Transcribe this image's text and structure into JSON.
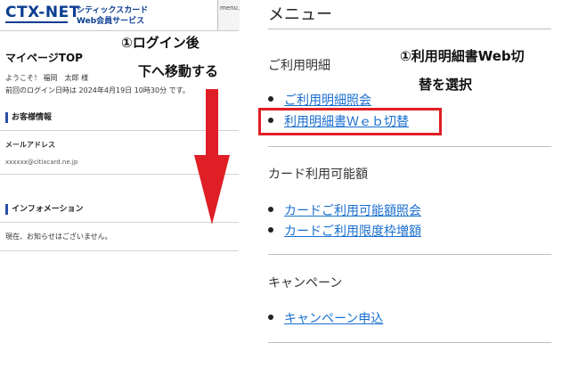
{
  "header": {
    "logo": "CTX-NET",
    "service_line1": "シティックスカード",
    "service_line2": "Web会員サービス",
    "menu_button": "menuメニュー"
  },
  "mypage": {
    "title": "マイページTOP",
    "welcome": "ようこそ！ 福岡　太郎 様",
    "last_login": "前回のログイン日時は 2024年4月19日 10時30分 です。",
    "customer_section": "お客様情報",
    "mail_label": "メールアドレス",
    "mail_value": "xxxxxx@citixcard.ne.jp",
    "info_section": "インフォメーション",
    "info_text": "現在、お知らせはございません。"
  },
  "annotations": {
    "left_line1": "①ログイン後",
    "left_line2": "下へ移動する",
    "right_line1": "①利用明細書Web切",
    "right_line2": "替を選択"
  },
  "menu": {
    "title": "メニュー",
    "groups": [
      {
        "title": "ご利用明細",
        "items": [
          "ご利用明細照会",
          "利用明細書Ｗｅｂ切替"
        ]
      },
      {
        "title": "カード利用可能額",
        "items": [
          "カードご利用可能額照会",
          "カードご利用限度枠増額"
        ]
      },
      {
        "title": "キャンペーン",
        "items": [
          "キャンペーン申込"
        ]
      }
    ]
  },
  "colors": {
    "accent_red": "#e01e25",
    "link_blue": "#1a6fcf",
    "brand_navy": "#0b3d91"
  }
}
